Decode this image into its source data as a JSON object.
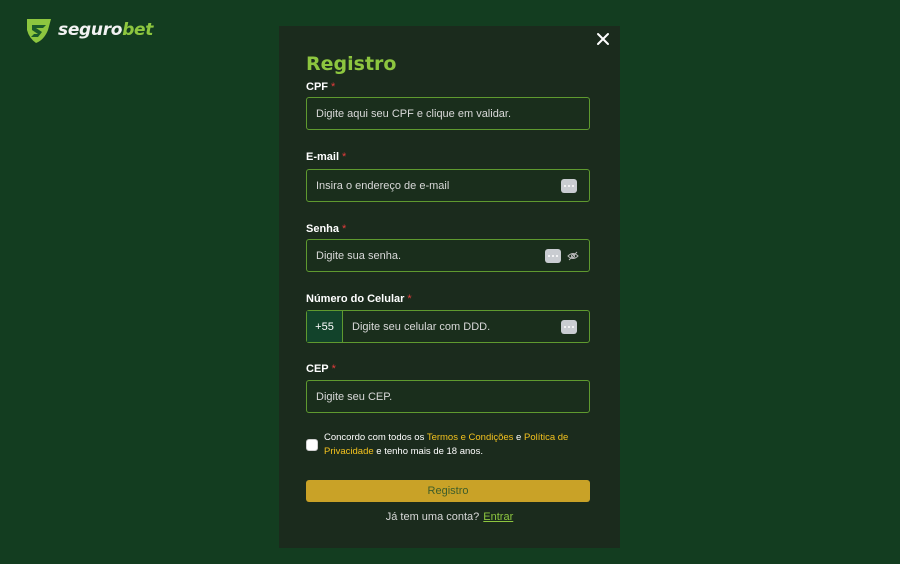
{
  "brand": {
    "name_part1": "seguro",
    "name_part2": "bet",
    "logo_color": "#8dc63f"
  },
  "modal": {
    "title": "Registro",
    "close_icon": "close-icon",
    "fields": {
      "cpf": {
        "label": "CPF",
        "required": "*",
        "placeholder": "Digite aqui seu CPF e clique em validar."
      },
      "email": {
        "label": "E-mail",
        "required": "*",
        "placeholder": "Insira o endereço de e-mail"
      },
      "password": {
        "label": "Senha",
        "required": "*",
        "placeholder": "Digite sua senha."
      },
      "phone": {
        "label": "Número do Celular",
        "required": "*",
        "prefix": "+55",
        "placeholder": "Digite seu celular com DDD."
      },
      "cep": {
        "label": "CEP",
        "required": "*",
        "placeholder": "Digite seu CEP."
      }
    },
    "terms": {
      "text_before": "Concordo com todos os ",
      "link1": "Termos e Condições",
      "text_mid": " e ",
      "link2": "Política de Privacidade",
      "text_after": " e tenho mais de 18 anos."
    },
    "submit_label": "Registro",
    "login_prompt": "Já tem uma conta?",
    "login_link": "Entrar"
  },
  "colors": {
    "page_bg": "#133d20",
    "modal_bg": "#1b2b1d",
    "accent_green": "#8dc63f",
    "field_border": "#5f9a2f",
    "button_gold": "#c9a227",
    "link_yellow": "#f4c21e",
    "required_red": "#e23b3b"
  }
}
